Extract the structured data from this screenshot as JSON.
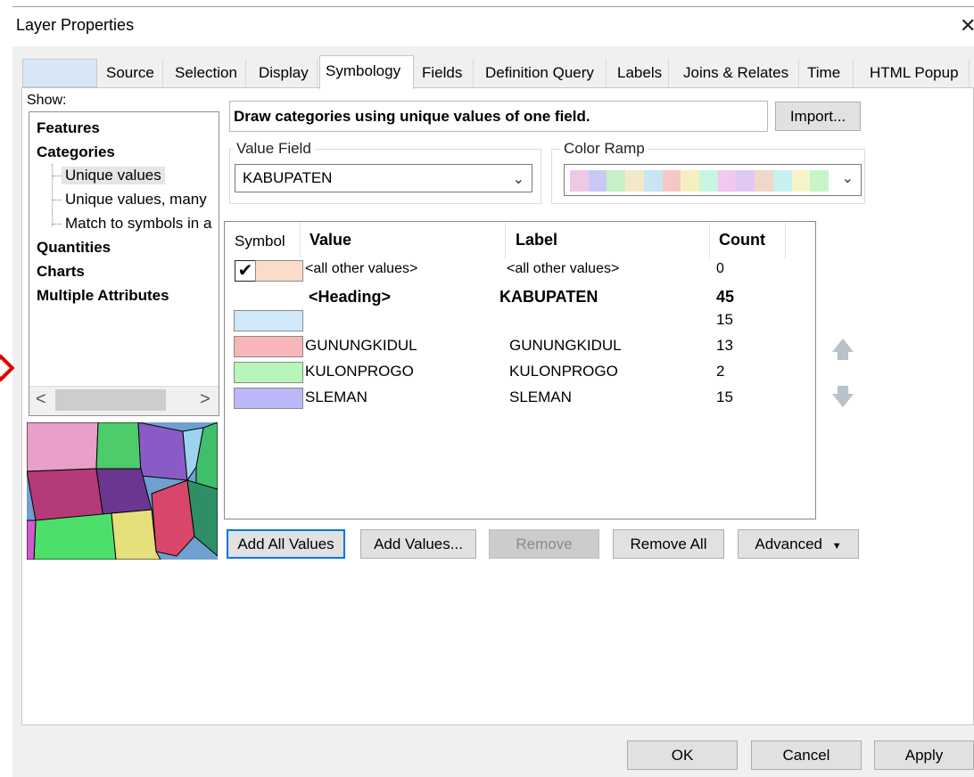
{
  "window": {
    "title": "Layer Properties",
    "close_glyph": "✕"
  },
  "tabs": [
    {
      "label": ""
    },
    {
      "label": "Source"
    },
    {
      "label": "Selection"
    },
    {
      "label": "Display"
    },
    {
      "label": "Symbology"
    },
    {
      "label": "Fields"
    },
    {
      "label": "Definition Query"
    },
    {
      "label": "Labels"
    },
    {
      "label": "Joins & Relates"
    },
    {
      "label": "Time"
    },
    {
      "label": "HTML Popup"
    }
  ],
  "active_tab": "Symbology",
  "show": {
    "label": "Show:",
    "items": [
      {
        "label": "Features"
      },
      {
        "label": "Categories"
      },
      {
        "label": "Unique values"
      },
      {
        "label": "Unique values, many"
      },
      {
        "label": "Match to symbols in a"
      },
      {
        "label": "Quantities"
      },
      {
        "label": "Charts"
      },
      {
        "label": "Multiple Attributes"
      }
    ],
    "scroll_left": "<",
    "scroll_right": ">"
  },
  "symbology": {
    "description": "Draw categories using unique values of one field.",
    "import_label": "Import...",
    "value_field": {
      "legend": "Value Field",
      "value": "KABUPATEN"
    },
    "color_ramp": {
      "legend": "Color Ramp",
      "colors": [
        "#f0c8e6",
        "#c9c8f5",
        "#c7f0c8",
        "#f5e8c8",
        "#c8e4f5",
        "#f5c8c8",
        "#f5f0c0",
        "#c8f5e0",
        "#f0c8f0",
        "#e0c8f5",
        "#f0d8c8",
        "#c8f0f0",
        "#f5f5c8",
        "#c8f5c8"
      ]
    },
    "table": {
      "headers": {
        "symbol": "Symbol",
        "value": "Value",
        "label": "Label",
        "count": "Count"
      },
      "rows": [
        {
          "color": "#fbdcc8",
          "checked": true,
          "value": "<all other values>",
          "label": "<all other values>",
          "count": "0",
          "bold": false,
          "small": true
        },
        {
          "color": "",
          "checked": false,
          "value": "<Heading>",
          "label": "KABUPATEN",
          "count": "45",
          "bold": true,
          "small": false
        },
        {
          "color": "#cfe9fb",
          "checked": false,
          "value": "",
          "label": "",
          "count": "15",
          "bold": false,
          "small": false
        },
        {
          "color": "#f8b6b8",
          "checked": false,
          "value": "GUNUNGKIDUL",
          "label": "GUNUNGKIDUL",
          "count": "13",
          "bold": false,
          "small": false
        },
        {
          "color": "#b8f5b8",
          "checked": false,
          "value": "KULONPROGO",
          "label": "KULONPROGO",
          "count": "2",
          "bold": false,
          "small": false
        },
        {
          "color": "#bcb8f8",
          "checked": false,
          "value": "SLEMAN",
          "label": "SLEMAN",
          "count": "15",
          "bold": false,
          "small": false
        }
      ]
    },
    "buttons": {
      "add_all": "Add All Values",
      "add_values": "Add Values...",
      "remove": "Remove",
      "remove_all": "Remove All",
      "advanced": "Advanced"
    },
    "move_up_glyph": "🡅",
    "move_down_glyph": "🡇"
  },
  "footer": {
    "ok": "OK",
    "cancel": "Cancel",
    "apply": "Apply"
  }
}
